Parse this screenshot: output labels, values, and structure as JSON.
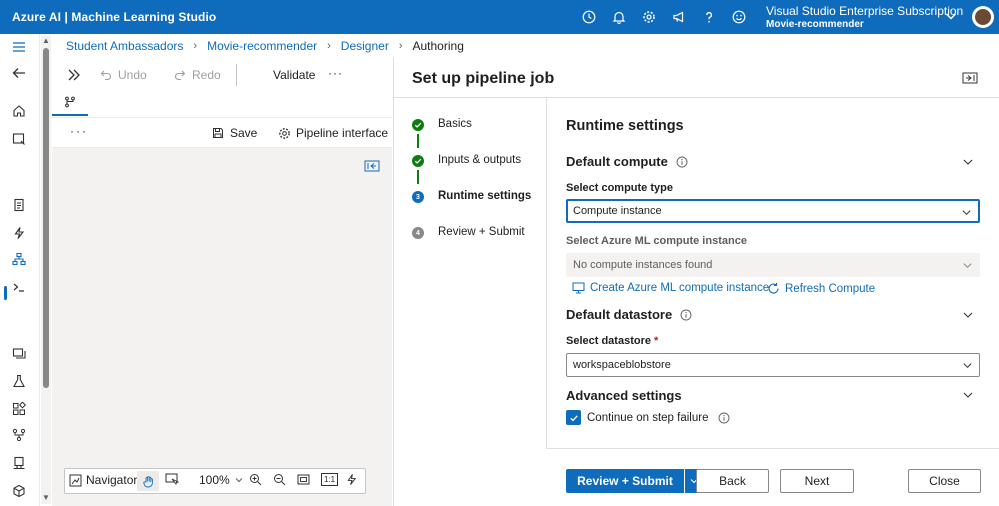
{
  "topbar": {
    "brand": "Azure AI | Machine Learning Studio",
    "subscription": "Visual Studio Enterprise Subscription",
    "workspace": "Movie-recommender",
    "icons": [
      "clock-icon",
      "bell-icon",
      "gear-icon",
      "megaphone-icon",
      "help-icon",
      "smiley-icon"
    ]
  },
  "breadcrumb": {
    "items": [
      "Student Ambassadors",
      "Movie-recommender",
      "Designer",
      "Authoring"
    ]
  },
  "canvas": {
    "toolbar": {
      "undo": "Undo",
      "redo": "Redo",
      "validate": "Validate",
      "more": "···"
    },
    "actions": {
      "more": "···",
      "save": "Save",
      "pipeline_interface": "Pipeline interface"
    },
    "navbar": {
      "navigator": "Navigator",
      "zoom": "100%",
      "one_to_one": "1:1"
    }
  },
  "panel": {
    "title": "Set up pipeline job",
    "steps": [
      {
        "label": "Basics",
        "state": "done"
      },
      {
        "label": "Inputs & outputs",
        "state": "done"
      },
      {
        "label": "Runtime settings",
        "state": "current",
        "num": "3"
      },
      {
        "label": "Review + Submit",
        "state": "todo",
        "num": "4"
      }
    ],
    "form": {
      "heading": "Runtime settings",
      "default_compute": "Default compute",
      "compute_type_label": "Select compute type",
      "compute_type_value": "Compute instance",
      "instance_label": "Select Azure ML compute instance",
      "instance_value": "No compute instances found",
      "create_link": "Create Azure ML compute instance",
      "refresh_link": "Refresh Compute",
      "default_datastore": "Default datastore",
      "datastore_label": "Select datastore",
      "datastore_required": "*",
      "datastore_value": "workspaceblobstore",
      "advanced": "Advanced settings",
      "continue_on_failure": "Continue on step failure"
    },
    "footer": {
      "review_submit": "Review + Submit",
      "back": "Back",
      "next": "Next",
      "close": "Close"
    }
  },
  "colors": {
    "accent": "#0f6cbd",
    "success": "#107c10",
    "required": "#a4262c"
  }
}
